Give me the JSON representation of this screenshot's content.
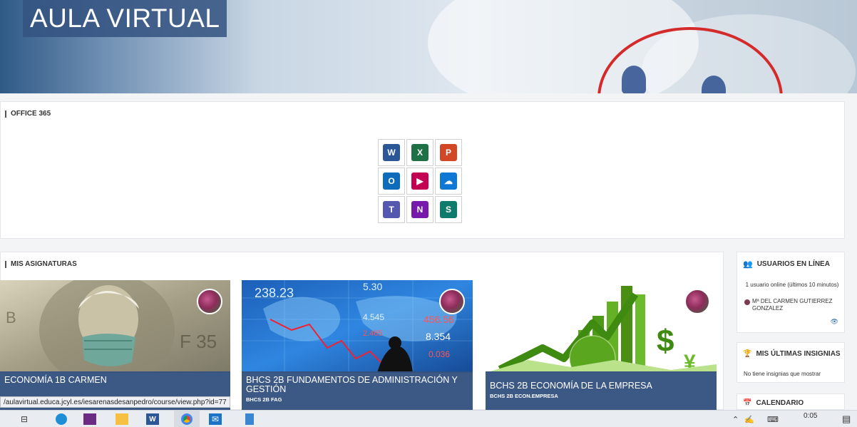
{
  "banner": {
    "title": "AULA VIRTUAL"
  },
  "office": {
    "title": "OFFICE 365",
    "apps": [
      {
        "name": "word",
        "letter": "W",
        "color": "#2b5797"
      },
      {
        "name": "excel",
        "letter": "X",
        "color": "#1e7145"
      },
      {
        "name": "powerpoint",
        "letter": "P",
        "color": "#d24726"
      },
      {
        "name": "outlook",
        "letter": "O",
        "color": "#0f6cbd"
      },
      {
        "name": "stream",
        "letter": "▶",
        "color": "#c30052"
      },
      {
        "name": "onedrive",
        "letter": "☁",
        "color": "#0f78d4"
      },
      {
        "name": "teams",
        "letter": "T",
        "color": "#5558af"
      },
      {
        "name": "onenote",
        "letter": "N",
        "color": "#7719aa"
      },
      {
        "name": "sway",
        "letter": "S",
        "color": "#0f7b6c"
      }
    ]
  },
  "courses": {
    "title": "MIS ASIGNATURAS",
    "items": [
      {
        "title": "ECONOMÍA 1B CARMEN",
        "short": ""
      },
      {
        "title": "BHCS 2B FUNDAMENTOS DE ADMINISTRACIÓN Y GESTIÓN",
        "short": "BHCS 2B FAG"
      },
      {
        "title": "BCHS 2B ECONOMÍA DE LA EMPRESA",
        "short": "BCHS 2B ECON.EMPRESA"
      }
    ],
    "stock_numbers": [
      "238.23",
      "5.30",
      "4.545",
      "456.56",
      "8.354",
      "2.465",
      "0.036"
    ]
  },
  "online_users": {
    "title": "USUARIOS EN LÍNEA",
    "summary": "1 usuario online (últimos 10 minutos)",
    "user": "Mª DEL CARMEN GUTIERREZ GONZALEZ"
  },
  "badges": {
    "title": "MIS ÚLTIMAS INSIGNIAS",
    "empty": "No tiene insignias que mostrar"
  },
  "calendar": {
    "title": "CALENDARIO"
  },
  "status_url": "/aulavirtual.educa.jcyl.es/iesarenasdesanpedro/course/view.php?id=77",
  "taskbar": {
    "time": "0:05"
  }
}
